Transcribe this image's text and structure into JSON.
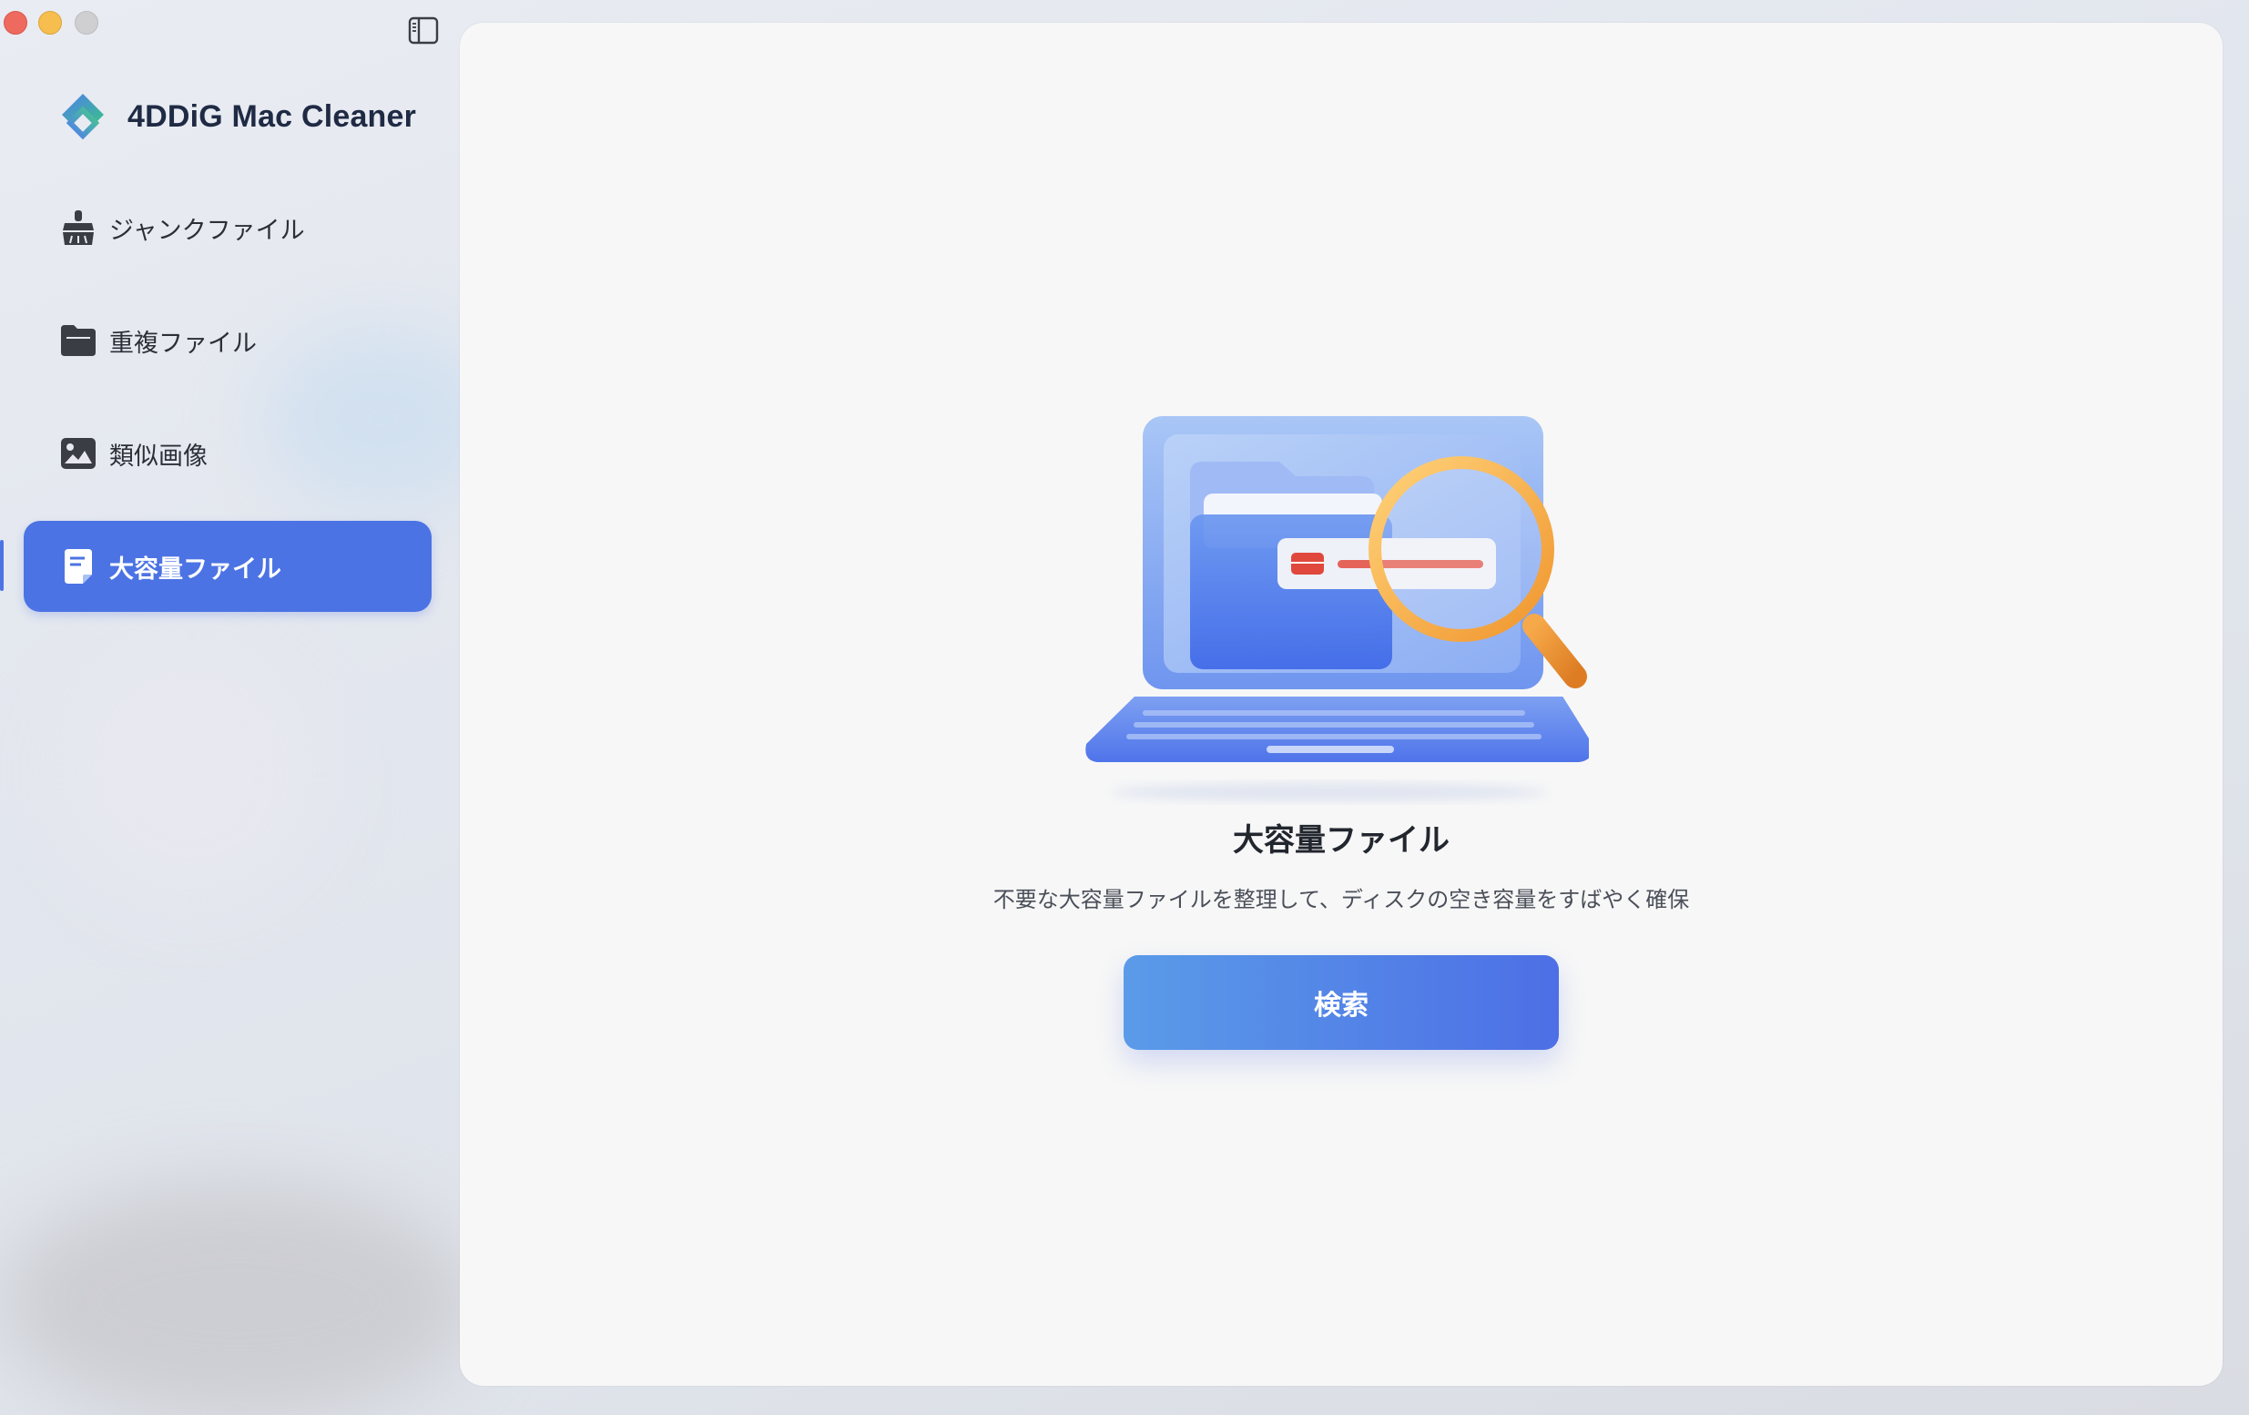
{
  "window": {
    "controls": [
      "close",
      "minimize",
      "zoom"
    ]
  },
  "app": {
    "name": "4DDiG Mac Cleaner"
  },
  "sidebar": {
    "items": [
      {
        "label": "ジャンクファイル",
        "icon": "broom-icon",
        "active": false
      },
      {
        "label": "重複ファイル",
        "icon": "folder-icon",
        "active": false
      },
      {
        "label": "類似画像",
        "icon": "image-icon",
        "active": false
      },
      {
        "label": "大容量ファイル",
        "icon": "document-icon",
        "active": true
      }
    ]
  },
  "main": {
    "title": "大容量ファイル",
    "description": "不要な大容量ファイルを整理して、ディスクの空き容量をすばやく確保",
    "scan_button": "検索"
  },
  "colors": {
    "accent": "#4c73e4",
    "button_gradient_start": "#5a9be8",
    "button_gradient_end": "#4d6fe6",
    "traffic_close": "#ee6a5f",
    "traffic_minimize": "#f5be4f",
    "traffic_zoom": "#cfcfd2"
  }
}
